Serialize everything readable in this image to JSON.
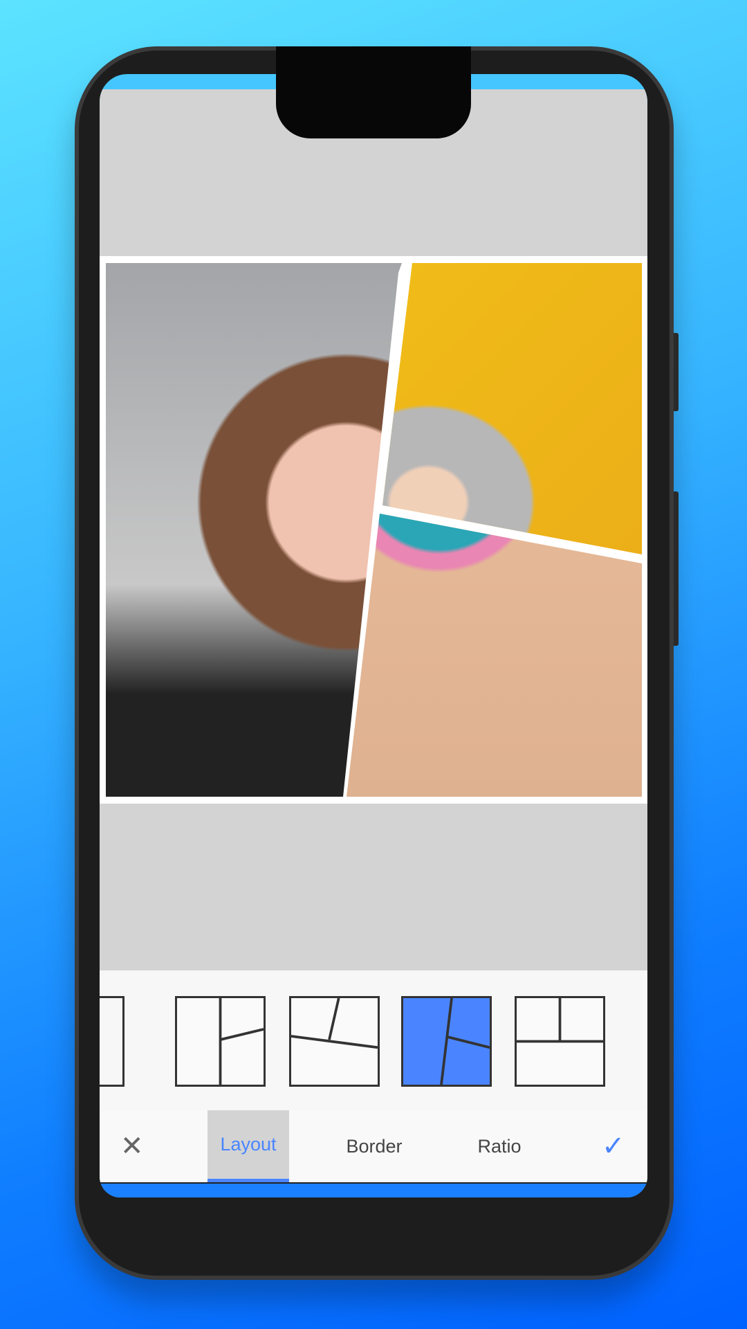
{
  "toolbar": {
    "cancel_icon": "close-icon",
    "confirm_icon": "check-icon",
    "tabs": [
      {
        "label": "Layout",
        "active": true
      },
      {
        "label": "Border",
        "active": false
      },
      {
        "label": "Ratio",
        "active": false
      }
    ]
  },
  "layouts": {
    "selected_index": 3,
    "items": [
      "partial",
      "vertical-split-right-angled",
      "top-angled-split",
      "tilted-vertical-split-selected",
      "top-two-bottom-one"
    ]
  },
  "colors": {
    "accent": "#4a85ff",
    "canvas": "#d3d3d3",
    "bar": "#1a80ff"
  }
}
